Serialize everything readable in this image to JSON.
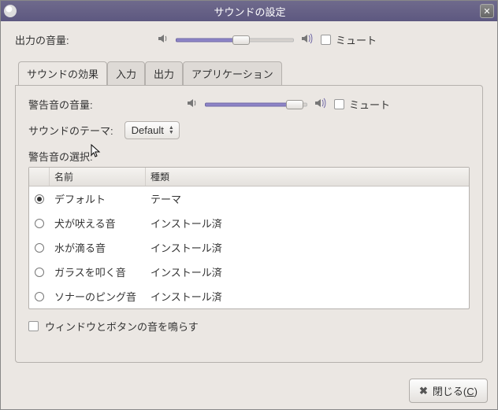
{
  "titlebar": {
    "title": "サウンドの設定",
    "close_aria": "close"
  },
  "output": {
    "label": "出力の音量:",
    "mute_label": "ミュート",
    "slider_percent": 55
  },
  "tabs": [
    {
      "label": "サウンドの効果",
      "active": true
    },
    {
      "label": "入力",
      "active": false
    },
    {
      "label": "出力",
      "active": false
    },
    {
      "label": "アプリケーション",
      "active": false
    }
  ],
  "panel": {
    "alert_volume_label": "警告音の音量:",
    "alert_mute_label": "ミュート",
    "alert_slider_percent": 88,
    "theme_label": "サウンドのテーマ:",
    "theme_value": "Default",
    "sounds_section_label": "警告音の選択:",
    "columns": {
      "name": "名前",
      "kind": "種類"
    },
    "items": [
      {
        "name": "デフォルト",
        "kind": "テーマ",
        "selected": true
      },
      {
        "name": "犬が吠える音",
        "kind": "インストール済",
        "selected": false
      },
      {
        "name": "水が滴る音",
        "kind": "インストール済",
        "selected": false
      },
      {
        "name": "ガラスを叩く音",
        "kind": "インストール済",
        "selected": false
      },
      {
        "name": "ソナーのピング音",
        "kind": "インストール済",
        "selected": false
      }
    ],
    "window_sounds_label": "ウィンドウとボタンの音を鳴らす"
  },
  "footer": {
    "close_label_pre": "閉じる(",
    "close_label_u": "C",
    "close_label_post": ")"
  }
}
